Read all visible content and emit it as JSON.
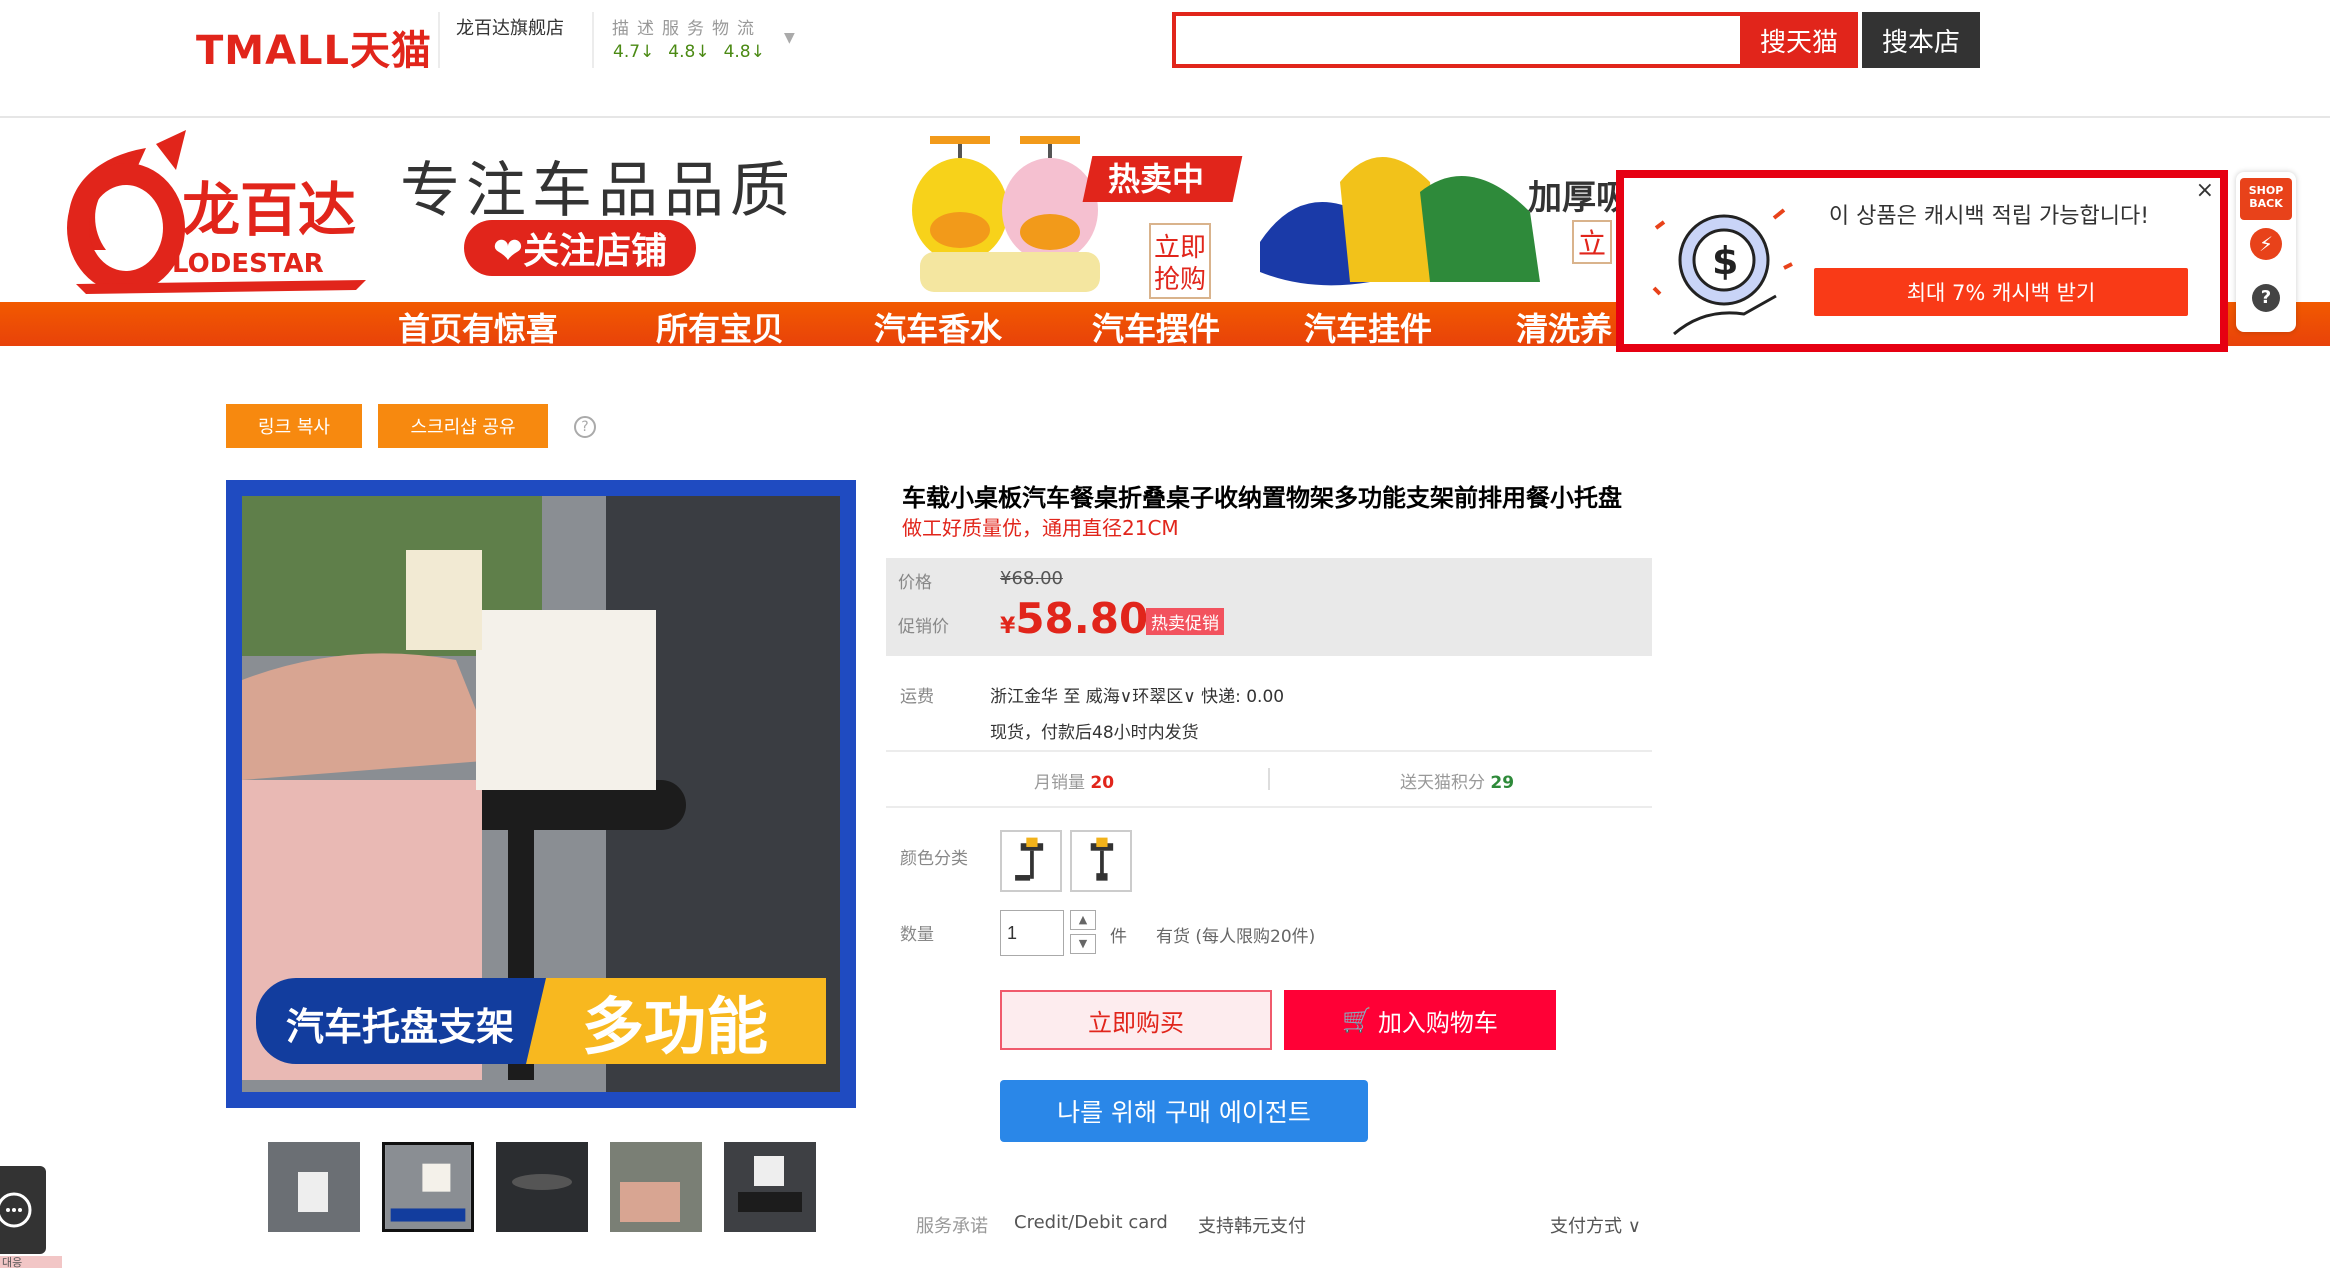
{
  "header": {
    "logo": "TMALL天猫",
    "shop_name": "龙百达旗舰店",
    "rating_labels": "描述服务物流",
    "ratings": [
      "4.7↓",
      "4.8↓",
      "4.8↓"
    ],
    "search_placeholder": "",
    "search_tmall_label": "搜天猫",
    "search_shop_label": "搜本店"
  },
  "banner": {
    "brand_name": "龙百达",
    "brand_name_en": "LODESTAR",
    "slogan": "专注车品品质",
    "follow_label": "❤关注店铺",
    "promo_tag": "热卖中",
    "promo_stamp_1": "立即",
    "promo_stamp_2": "抢购",
    "side_text": "加厚吸",
    "side_badge": "立",
    "nav_items": [
      "首页有惊喜",
      "所有宝贝",
      "汽车香水",
      "汽车摆件",
      "汽车挂件",
      "清洗养"
    ]
  },
  "cashback": {
    "message": "이 상품은 캐시백 적립 가능합니다!",
    "button_label": "최대 7% 캐시백 받기",
    "close_label": "×",
    "side_logo": "SHOP BACK",
    "side_help": "?"
  },
  "share": {
    "copy_link": "링크 복사",
    "scrap_share": "스크리샵 공유",
    "help": "?"
  },
  "product": {
    "title": "车载小桌板汽车餐桌折叠桌子收纳置物架多功能支架前排用餐小托盘",
    "subtitle": "做工好质量优，通用直径21CM",
    "image_caption_left": "汽车托盘支架",
    "image_caption_right": "多功能",
    "price_label": "价格",
    "original_price": "¥68.00",
    "promo_label": "促销价",
    "currency": "¥",
    "promo_price": "58.80",
    "hot_tag": "热卖促销",
    "shipping_label": "运费",
    "shipping_route": "浙江金华  至 威海∨环翠区∨ 快递: 0.00",
    "shipping_note": "现货，付款后48小时内发货",
    "monthly_sales_label": "月销量",
    "monthly_sales": "20",
    "points_label": "送天猫积分",
    "points": "29",
    "color_label": "颜色分类",
    "qty_label": "数量",
    "qty_value": "1",
    "qty_unit": "件",
    "stock_text": "有货  (每人限购20件)",
    "buy_now": "立即购买",
    "add_cart": "加入购物车",
    "agent_button": "나를 위해 구매 에이전트",
    "service_label": "服务承诺",
    "service_card": "Credit/Debit card",
    "service_krw": "支持韩元支付",
    "payment_label": "支付方式 ∨"
  },
  "chat": {
    "label": "대응"
  },
  "colors": {
    "tmall_red": "#e1251b",
    "nav_orange": "#f25a00",
    "agent_blue": "#2a87e8",
    "share_orange": "#f7890f"
  }
}
